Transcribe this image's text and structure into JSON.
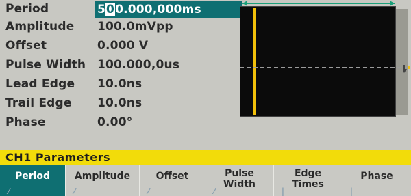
{
  "params": [
    {
      "label": "Period",
      "value_before_cursor": "5",
      "cursor_char": "0",
      "value_after_cursor": "0.000,000ms",
      "selected": true
    },
    {
      "label": "Amplitude",
      "value": "100.0mVpp"
    },
    {
      "label": "Offset",
      "value": "0.000 V"
    },
    {
      "label": "Pulse Width",
      "value": "100.000,0us"
    },
    {
      "label": "Lead Edge",
      "value": "10.0ns"
    },
    {
      "label": "Trail Edge",
      "value": "10.0ns"
    },
    {
      "label": "Phase",
      "value": "0.00°"
    }
  ],
  "title_bar": {
    "text": "CH1  Parameters"
  },
  "softkeys": [
    {
      "label": "Period",
      "active": true
    },
    {
      "label": "Amplitude",
      "active": false
    },
    {
      "label": "Offset",
      "active": false
    },
    {
      "label": "Pulse\nWidth",
      "active": false
    },
    {
      "label": "Edge\nTimes",
      "active": false
    },
    {
      "label": "Phase",
      "active": false
    }
  ],
  "colors": {
    "selected_bg": "#0f6f72",
    "title_bar_bg": "#f2dc0a",
    "pulse_color": "#f2c00a",
    "screen_bg": "#c8c8c2"
  }
}
